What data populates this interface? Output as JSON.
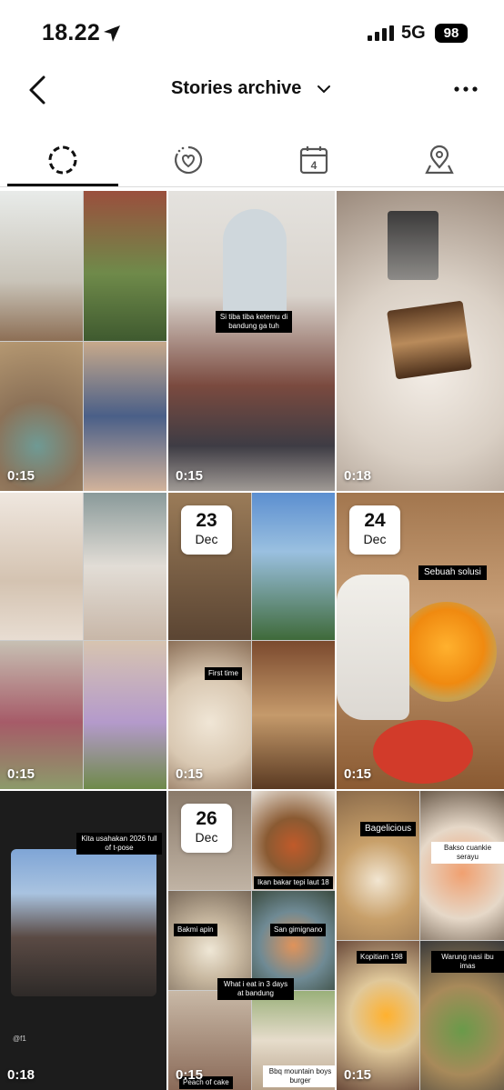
{
  "status": {
    "time": "18.22",
    "network": "5G",
    "battery": "98"
  },
  "header": {
    "title": "Stories archive"
  },
  "tabs": [
    {
      "name": "stories",
      "icon": "stories-ring-icon"
    },
    {
      "name": "memories",
      "icon": "heart-ring-icon"
    },
    {
      "name": "calendar",
      "icon": "calendar-icon",
      "day": "4"
    },
    {
      "name": "map",
      "icon": "location-pin-icon"
    }
  ],
  "tiles": [
    {
      "duration": "0:15"
    },
    {
      "duration": "0:15",
      "caption": "Si tiba tiba ketemu di bandung ga tuh"
    },
    {
      "duration": "0:18"
    },
    {
      "duration": "0:15"
    },
    {
      "duration": "0:15",
      "date_day": "23",
      "date_month": "Dec",
      "caption": "First time"
    },
    {
      "duration": "0:15",
      "date_day": "24",
      "date_month": "Dec",
      "caption": "Sebuah solusi"
    },
    {
      "duration": "0:18",
      "caption": "Kita usahakan 2026 full of t-pose",
      "credit": "@f1"
    },
    {
      "duration": "0:15",
      "date_day": "26",
      "date_month": "Dec",
      "captions": [
        "Ikan bakar tepi laut 18",
        "Bakmi apin",
        "San gimignano",
        "What i eat in 3 days at bandung",
        "Peach of cake",
        "Bbq mountain boys burger"
      ]
    },
    {
      "duration": "0:15",
      "captions": [
        "Bagelicious",
        "Bakso cuankie serayu",
        "Kopitiam 198",
        "Warung nasi ibu imas"
      ]
    }
  ]
}
